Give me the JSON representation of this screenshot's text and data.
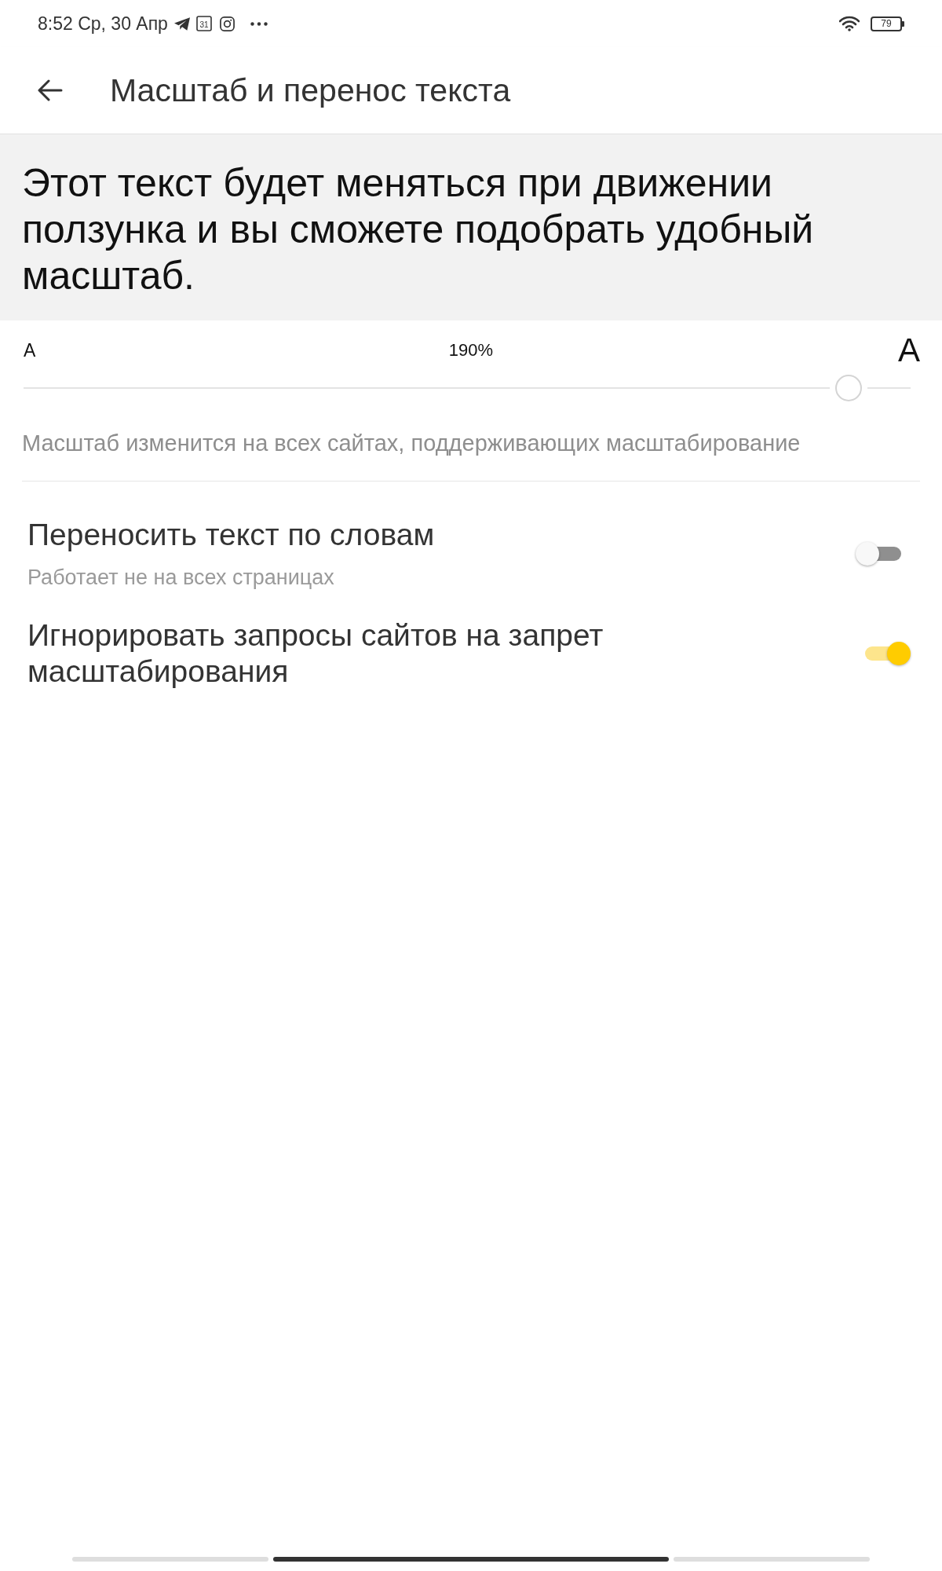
{
  "status_bar": {
    "time": "8:52 Ср, 30 Апр",
    "calendar_day": "31",
    "battery": "79"
  },
  "header": {
    "title": "Масштаб и перенос текста"
  },
  "preview": {
    "text": "Этот текст будет меняться при движении ползунка и вы сможете подобрать удобный масштаб."
  },
  "scale": {
    "min_label": "A",
    "value": "190%",
    "max_label": "A",
    "level": 0.93,
    "hint": "Масштаб изменится на всех сайтах, поддерживающих масштабирование"
  },
  "settings": [
    {
      "title": "Переносить текст по словам",
      "subtitle": "Работает не на всех страницах",
      "on": false
    },
    {
      "title": "Игнорировать запросы сайтов на запрет масштабирования",
      "on": true
    }
  ],
  "page_indicator": [
    {
      "selected": false
    },
    {
      "selected": true
    },
    {
      "selected": false
    }
  ]
}
